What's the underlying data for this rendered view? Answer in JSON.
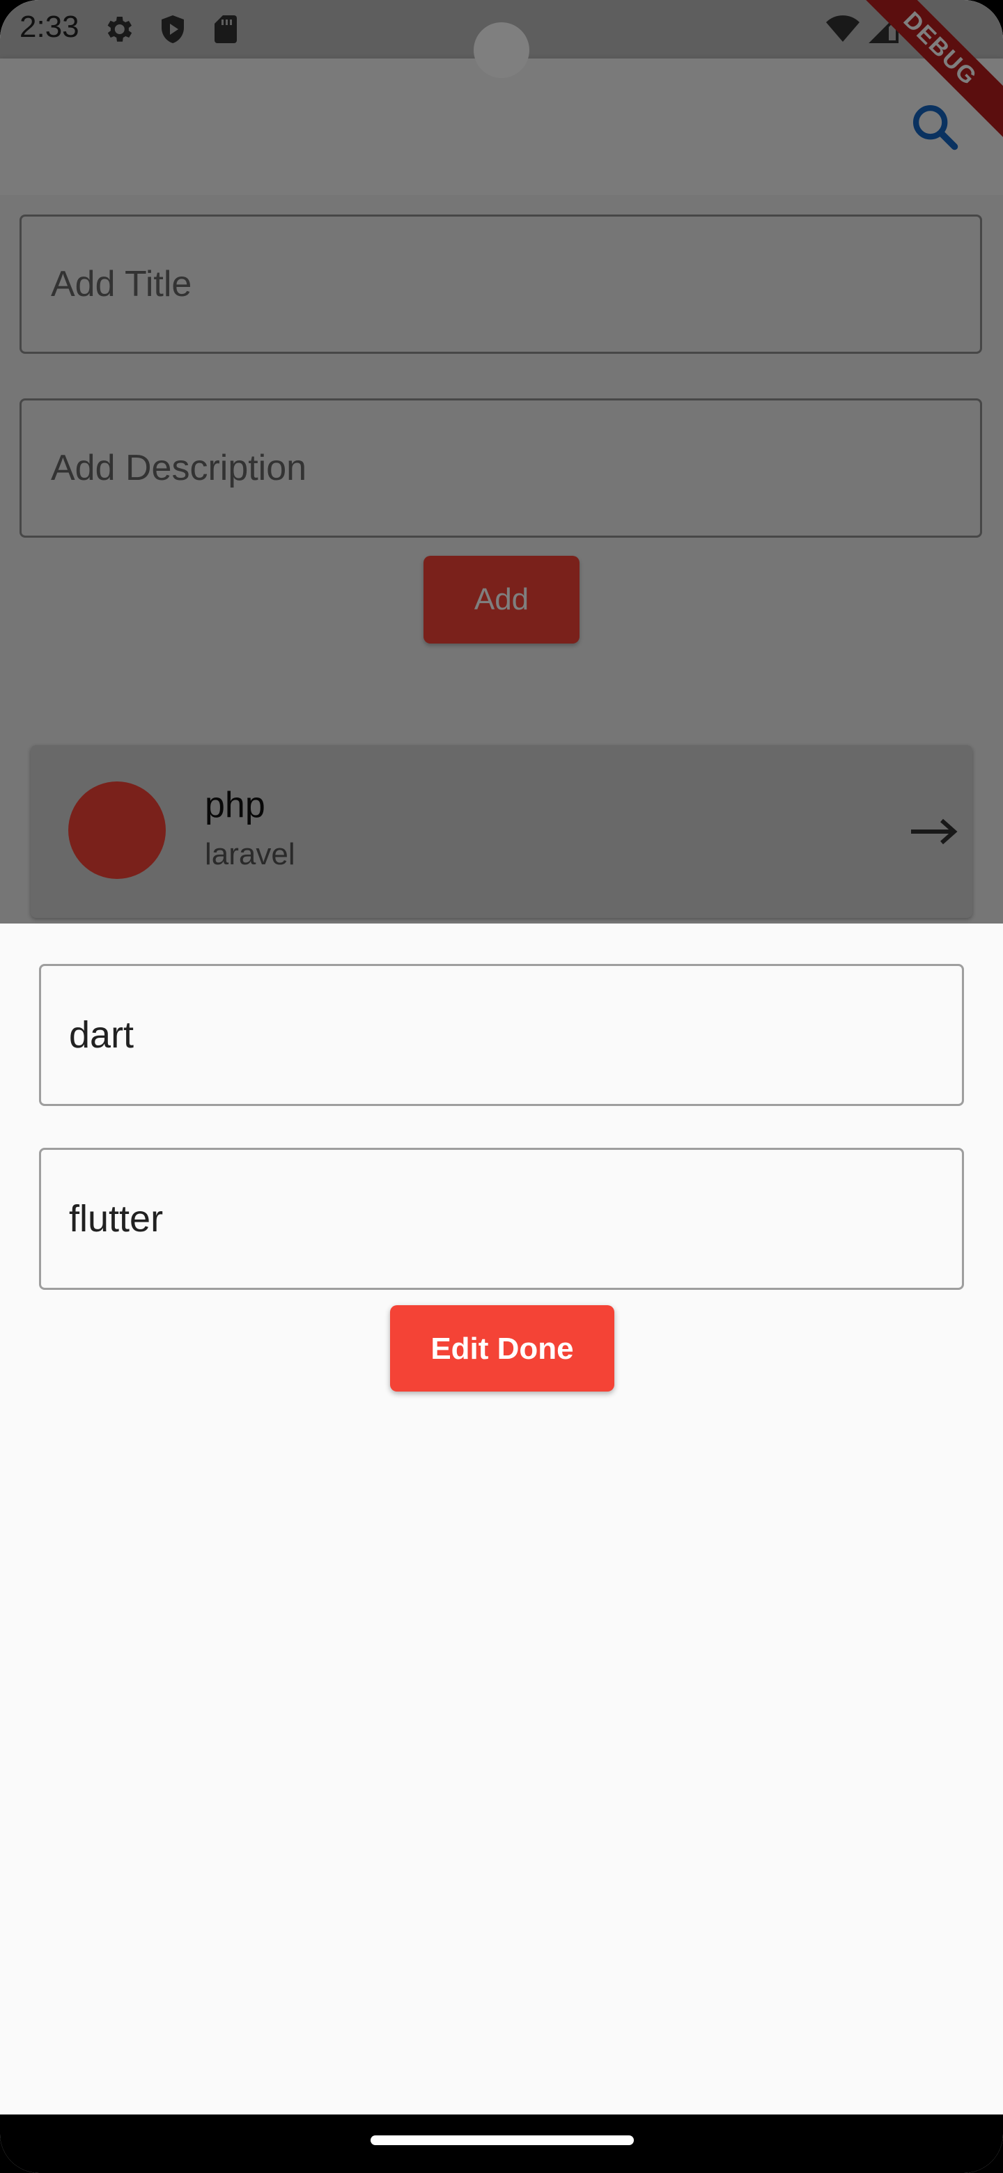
{
  "status_bar": {
    "time": "2:33",
    "icons": [
      "settings-icon",
      "shield-play-icon",
      "sd-card-icon",
      "wifi-icon",
      "cell-signal-icon"
    ]
  },
  "debug_banner": {
    "label": "DEBUG"
  },
  "app_bar": {
    "action_icon": "search-icon"
  },
  "form": {
    "title_placeholder": "Add Title",
    "description_placeholder": "Add Description",
    "add_button": "Add"
  },
  "list": {
    "items": [
      {
        "title": "php",
        "subtitle": "laravel",
        "trailing_icon": "arrow-right-icon"
      }
    ]
  },
  "edit_sheet": {
    "title_value": "dart",
    "description_value": "flutter",
    "done_button": "Edit Done"
  },
  "colors": {
    "accent": "#f44336",
    "search_icon": "#1565c0",
    "debug_banner": "#b71c1c"
  }
}
